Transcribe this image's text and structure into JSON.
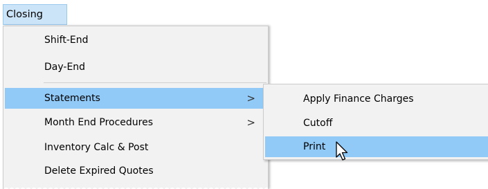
{
  "menubar": {
    "closing_label": "Closing"
  },
  "menu": {
    "items": [
      {
        "label": "Shift-End"
      },
      {
        "label": "Day-End"
      },
      {
        "label": "Statements",
        "arrow": ">"
      },
      {
        "label": "Month End Procedures",
        "arrow": ">"
      },
      {
        "label": "Inventory Calc & Post"
      },
      {
        "label": "Delete Expired Quotes"
      }
    ]
  },
  "submenu": {
    "items": [
      {
        "label": "Apply Finance Charges"
      },
      {
        "label": "Cutoff"
      },
      {
        "label": "Print"
      }
    ]
  },
  "colors": {
    "highlight": "#91c9f7",
    "menu_bg": "#f2f2f2",
    "menubar_active": "#cce4f7"
  },
  "icons": {
    "cursor": "arrow-pointer-icon"
  }
}
